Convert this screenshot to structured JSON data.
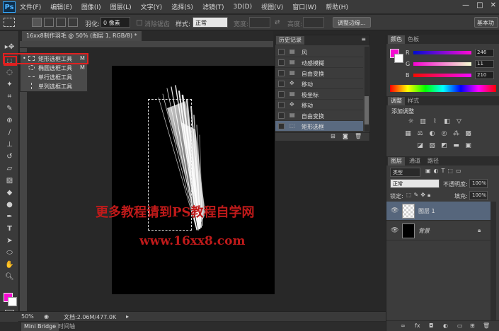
{
  "app": {
    "logo": "Ps"
  },
  "menubar": {
    "items": [
      "文件(F)",
      "编辑(E)",
      "图像(I)",
      "图层(L)",
      "文字(Y)",
      "选择(S)",
      "滤镜(T)",
      "3D(D)",
      "视图(V)",
      "窗口(W)",
      "帮助(H)"
    ],
    "window_controls": [
      "—",
      "□",
      "✕"
    ]
  },
  "options_bar": {
    "feather_label": "羽化:",
    "feather_value": "0 像素",
    "antialias_label": "消除锯齿",
    "style_label": "样式:",
    "style_value": "正常",
    "width_label": "宽度:",
    "height_label": "高度:",
    "refine_edge_button": "调整边缘...",
    "workspace": "基本功"
  },
  "document": {
    "tab_title": "16xx8制作羽毛 @ 50% (图层 1, RGB/8) *",
    "zoom": "50%",
    "doc_info": "文档:2.06M/477.0K"
  },
  "watermark": {
    "line1": "更多教程请到PS教程自学网",
    "line2": "www.16xx8.com"
  },
  "tool_flyout": {
    "items": [
      {
        "label": "矩形选框工具",
        "shortcut": "M"
      },
      {
        "label": "椭圆选框工具",
        "shortcut": "M"
      },
      {
        "label": "单行选框工具",
        "shortcut": ""
      },
      {
        "label": "单列选框工具",
        "shortcut": ""
      }
    ]
  },
  "history": {
    "title": "历史记录",
    "items": [
      "风",
      "动感模糊",
      "自由变换",
      "移动",
      "极坐标",
      "移动",
      "自由变换",
      "矩形选框"
    ]
  },
  "color_panel": {
    "tabs": [
      "颜色",
      "色板"
    ],
    "r_label": "R",
    "g_label": "G",
    "b_label": "B",
    "r_value": "246",
    "g_value": "11",
    "b_value": "210",
    "fg_color": "#F60BD2"
  },
  "adjustments_panel": {
    "tabs": [
      "调整",
      "样式"
    ],
    "heading": "添加调整"
  },
  "layers_panel": {
    "tabs": [
      "图层",
      "通道",
      "路径"
    ],
    "kind_filter": "类型",
    "blend_mode": "正常",
    "opacity_label": "不透明度:",
    "opacity_value": "100%",
    "lock_label": "锁定:",
    "fill_label": "填充:",
    "fill_value": "100%",
    "layers": [
      {
        "name": "图层 1",
        "selected": true
      },
      {
        "name": "背景",
        "selected": false,
        "locked": true
      }
    ]
  },
  "bottom_tabs": [
    "Mini Bridge",
    "时间轴"
  ],
  "accent_colors": {
    "highlight_red": "#E02020",
    "watermark_red": "#C01A1A",
    "magenta": "#F60BD2"
  }
}
